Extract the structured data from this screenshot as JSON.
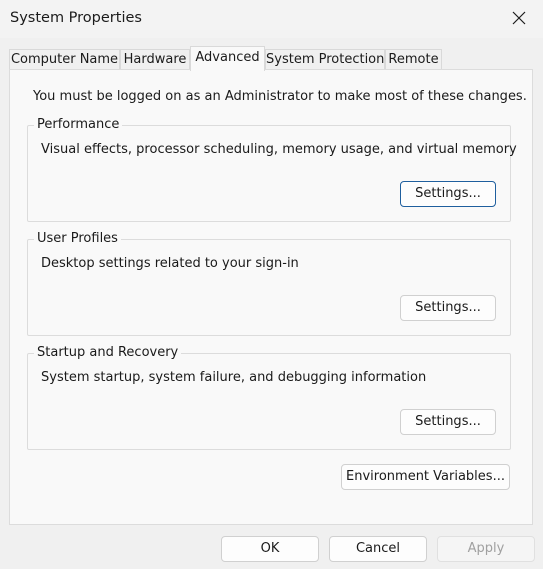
{
  "window": {
    "title": "System Properties"
  },
  "tabs": [
    {
      "label": "Computer Name"
    },
    {
      "label": "Hardware"
    },
    {
      "label": "Advanced",
      "active": true
    },
    {
      "label": "System Protection"
    },
    {
      "label": "Remote"
    }
  ],
  "panel": {
    "admin_note": "You must be logged on as an Administrator to make most of these changes.",
    "groups": [
      {
        "title": "Performance",
        "description": "Visual effects, processor scheduling, memory usage, and virtual memory",
        "button": "Settings..."
      },
      {
        "title": "User Profiles",
        "description": "Desktop settings related to your sign-in",
        "button": "Settings..."
      },
      {
        "title": "Startup and Recovery",
        "description": "System startup, system failure, and debugging information",
        "button": "Settings..."
      }
    ],
    "env_button": "Environment Variables..."
  },
  "footer": {
    "ok": "OK",
    "cancel": "Cancel",
    "apply": "Apply"
  },
  "colors": {
    "focus_border": "#1f5f9e",
    "panel_bg": "#f9f9f9",
    "window_bg": "#f0f0f0"
  },
  "icons": {
    "close": "close-icon"
  }
}
